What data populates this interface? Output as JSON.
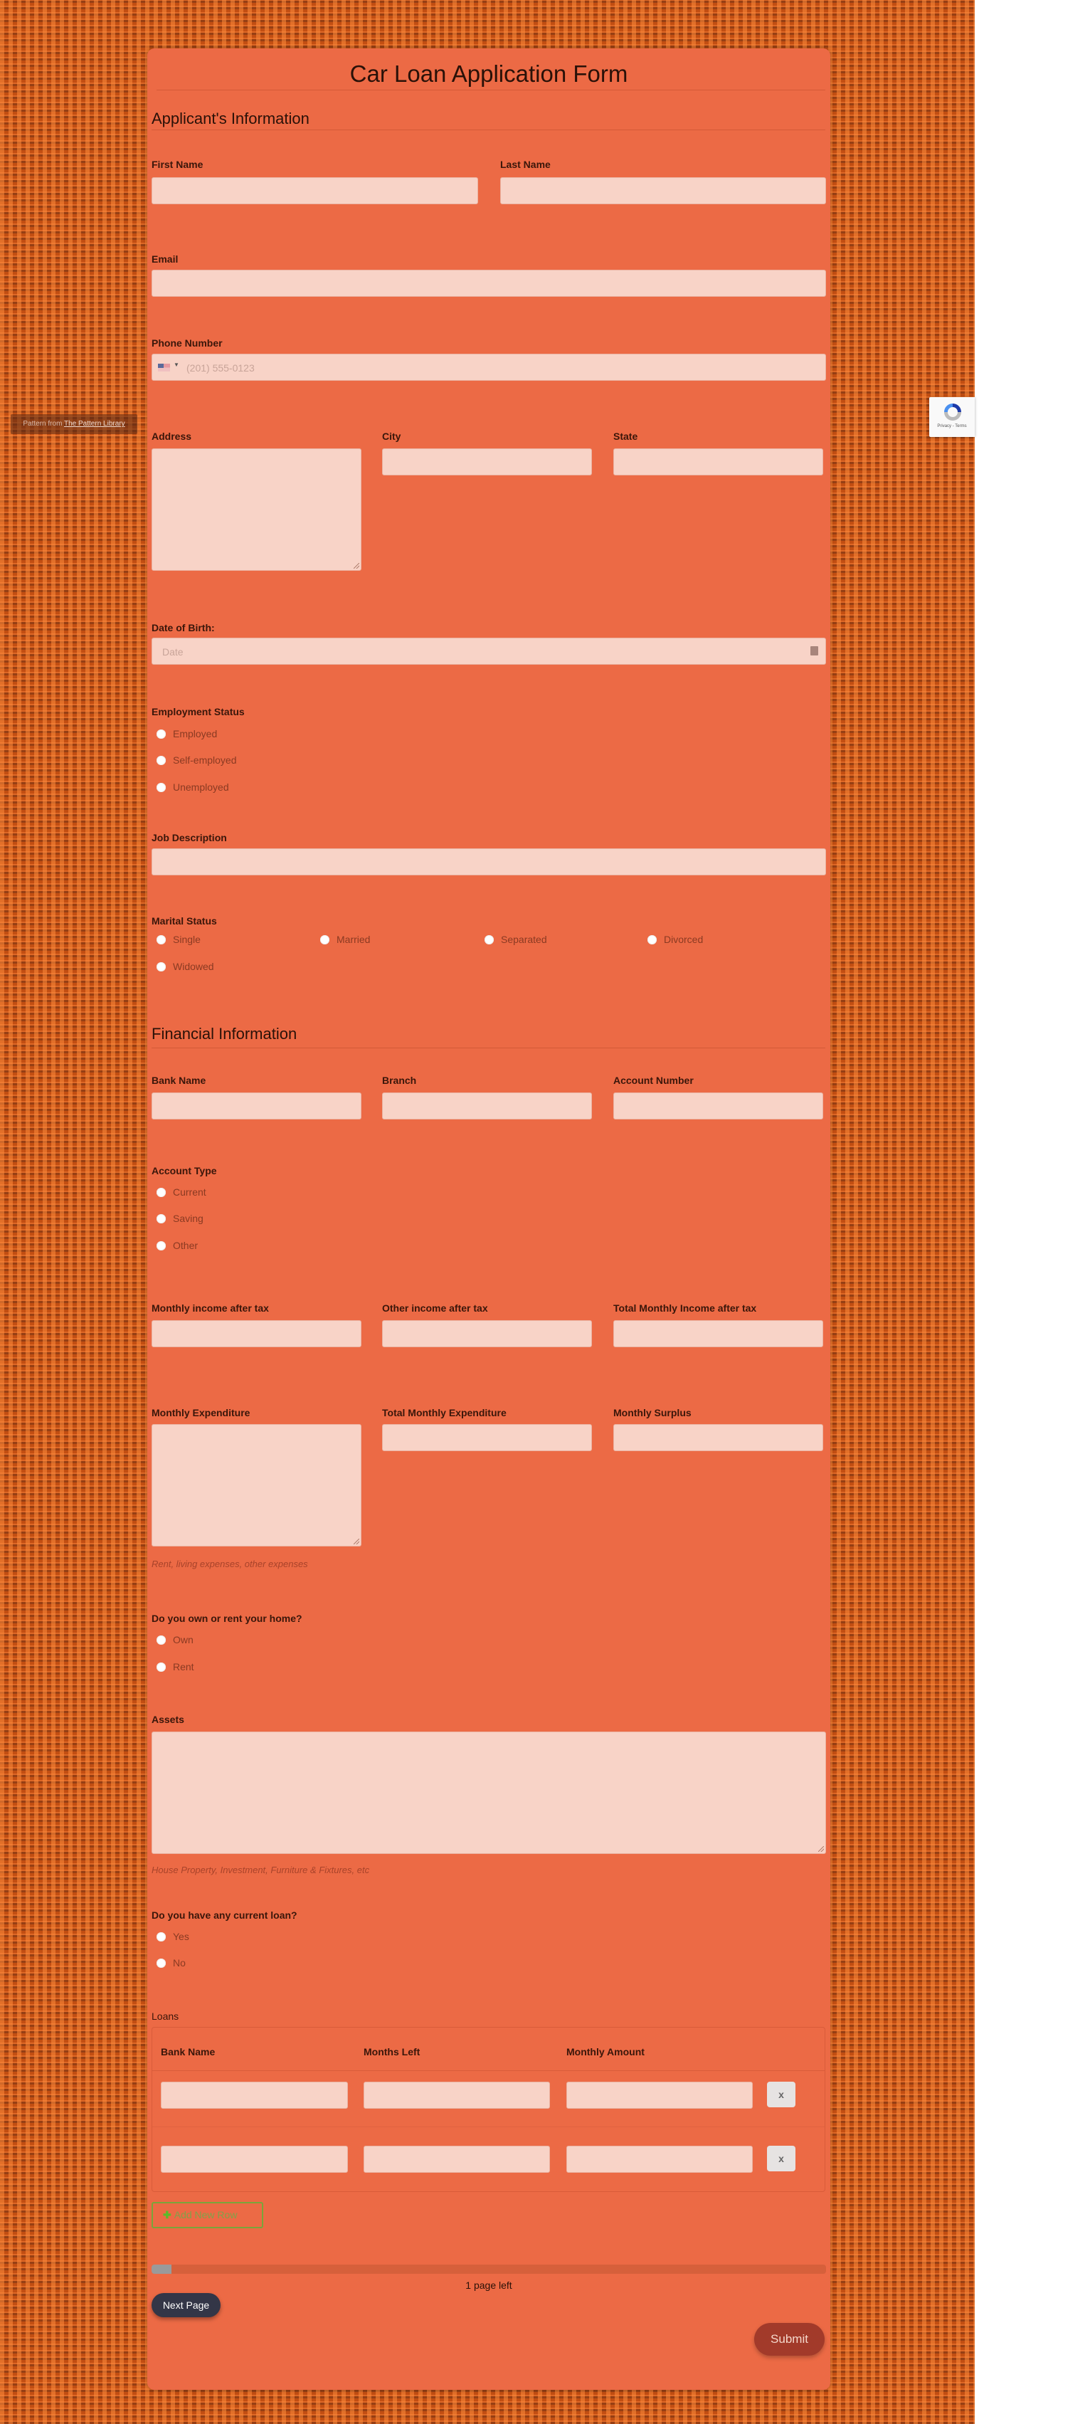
{
  "page": {
    "credit": {
      "prefix": "Pattern from ",
      "link": "The Pattern Library"
    },
    "recaptcha": {
      "text": "Privacy - Terms"
    }
  },
  "form": {
    "title": "Car Loan Application Form",
    "sections": {
      "applicant": "Applicant's Information",
      "financial": "Financial Information"
    },
    "fields": {
      "first_name": {
        "label": "First Name",
        "value": ""
      },
      "last_name": {
        "label": "Last Name",
        "value": ""
      },
      "email": {
        "label": "Email",
        "value": ""
      },
      "phone": {
        "label": "Phone Number",
        "placeholder": "(201) 555-0123",
        "country": "US"
      },
      "address": {
        "label": "Address",
        "value": ""
      },
      "city": {
        "label": "City",
        "value": ""
      },
      "state": {
        "label": "State",
        "value": ""
      },
      "dob": {
        "label": "Date of Birth:",
        "placeholder": "Date"
      },
      "employment_status": {
        "label": "Employment Status",
        "options": [
          "Employed",
          "Self-employed",
          "Unemployed"
        ]
      },
      "job_description": {
        "label": "Job Description",
        "value": ""
      },
      "marital_status": {
        "label": "Marital Status",
        "options": [
          "Single",
          "Married",
          "Separated",
          "Divorced",
          "Widowed"
        ]
      },
      "bank_name": {
        "label": "Bank Name",
        "value": ""
      },
      "branch": {
        "label": "Branch",
        "value": ""
      },
      "account_number": {
        "label": "Account Number",
        "value": ""
      },
      "account_type": {
        "label": "Account Type",
        "options": [
          "Current",
          "Saving",
          "Other"
        ]
      },
      "monthly_income": {
        "label": "Monthly income after tax",
        "value": ""
      },
      "other_income": {
        "label": "Other income after tax",
        "value": ""
      },
      "total_income": {
        "label": "Total Monthly Income after tax",
        "value": ""
      },
      "monthly_expenditure": {
        "label": "Monthly Expenditure",
        "hint": "Rent, living expenses, other expenses"
      },
      "total_expenditure": {
        "label": "Total Monthly Expenditure",
        "value": ""
      },
      "monthly_surplus": {
        "label": "Monthly Surplus",
        "value": ""
      },
      "own_rent": {
        "label": "Do you own or rent your home?",
        "options": [
          "Own",
          "Rent"
        ]
      },
      "assets": {
        "label": "Assets",
        "hint": "House Property, Investment, Furniture & Fixtures, etc"
      },
      "current_loan": {
        "label": "Do you have any current loan?",
        "options": [
          "Yes",
          "No"
        ]
      }
    },
    "loans": {
      "label": "Loans",
      "columns": [
        "Bank Name",
        "Months Left",
        "Monthly Amount"
      ],
      "rows": [
        {
          "bank_name": "",
          "months_left": "",
          "monthly_amount": ""
        },
        {
          "bank_name": "",
          "months_left": "",
          "monthly_amount": ""
        }
      ],
      "delete_label": "x",
      "add_label": "Add New Row"
    },
    "progress": {
      "percent": 3,
      "text": "1 page left"
    },
    "buttons": {
      "next": "Next Page",
      "submit": "Submit"
    }
  }
}
